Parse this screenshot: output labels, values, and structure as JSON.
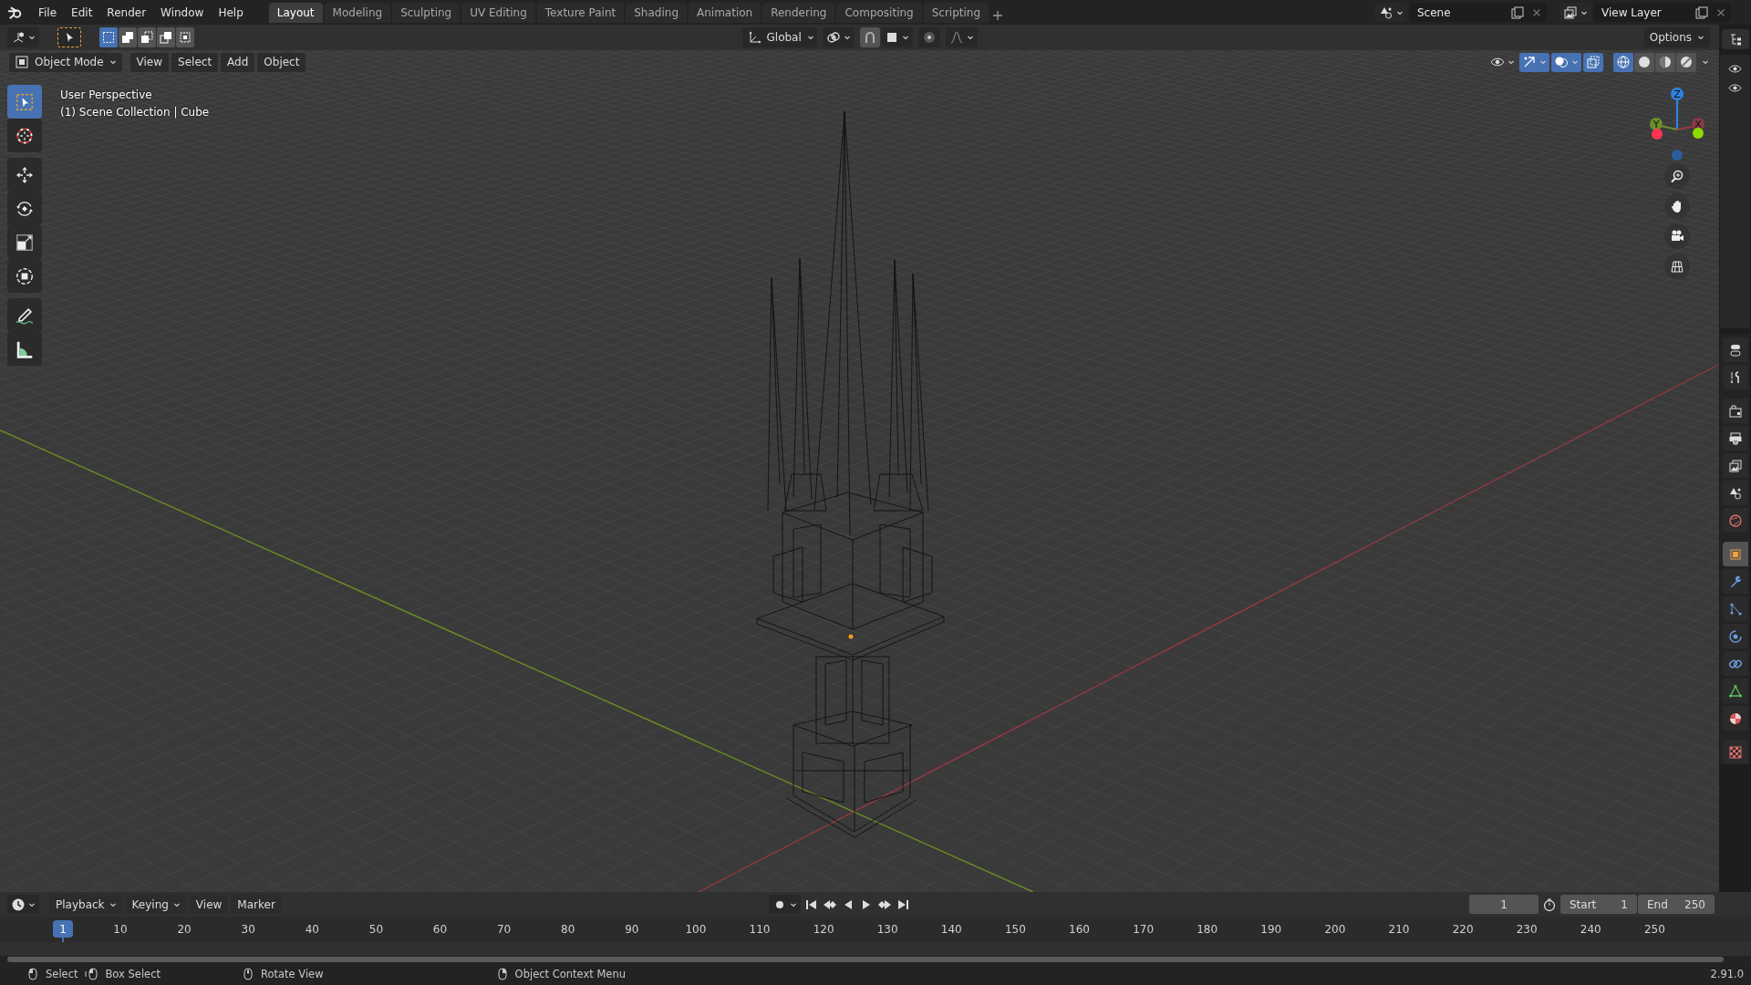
{
  "menu_bar": {
    "menus": [
      "File",
      "Edit",
      "Render",
      "Window",
      "Help"
    ]
  },
  "workspaces": [
    {
      "label": "Layout",
      "selected": true
    },
    {
      "label": "Modeling",
      "selected": false
    },
    {
      "label": "Sculpting",
      "selected": false
    },
    {
      "label": "UV Editing",
      "selected": false
    },
    {
      "label": "Texture Paint",
      "selected": false
    },
    {
      "label": "Shading",
      "selected": false
    },
    {
      "label": "Animation",
      "selected": false
    },
    {
      "label": "Rendering",
      "selected": false
    },
    {
      "label": "Compositing",
      "selected": false
    },
    {
      "label": "Scripting",
      "selected": false
    }
  ],
  "scene": {
    "name": "Scene"
  },
  "view_layer": {
    "name": "View Layer"
  },
  "tool_header": {
    "select_modes": [
      {
        "selected": true
      },
      {
        "selected": false
      },
      {
        "selected": false
      },
      {
        "selected": false
      },
      {
        "selected": false
      }
    ],
    "orientation": "Global",
    "options": "Options"
  },
  "viewport": {
    "mode": "Object Mode",
    "menus": [
      "View",
      "Select",
      "Add",
      "Object"
    ],
    "perspective": "User Perspective",
    "collection": "(1) Scene Collection | Cube",
    "overlays": [
      {
        "kind": "visibility",
        "on": false
      },
      {
        "kind": "gizmos",
        "on": true
      },
      {
        "kind": "overlays",
        "on": true
      },
      {
        "kind": "xray",
        "on": true
      }
    ],
    "shading": [
      {
        "kind": "wireframe",
        "selected": true
      },
      {
        "kind": "solid",
        "selected": false
      },
      {
        "kind": "material",
        "selected": false
      },
      {
        "kind": "rendered",
        "selected": false
      }
    ],
    "tools": [
      {
        "kind": "select_box",
        "selected": true
      },
      {
        "kind": "cursor",
        "selected": false
      },
      {
        "kind": "move",
        "selected": false
      },
      {
        "kind": "rotate",
        "selected": false
      },
      {
        "kind": "scale",
        "selected": false
      },
      {
        "kind": "transform",
        "selected": false
      },
      {
        "kind": "annotate",
        "selected": false
      },
      {
        "kind": "measure",
        "selected": false
      }
    ],
    "gizmo_axes": [
      "Z",
      "Y",
      "X"
    ]
  },
  "properties_tabs": [
    {
      "kind": "tool",
      "selected": false
    },
    {
      "kind": "render",
      "selected": false
    },
    {
      "kind": "output",
      "selected": false
    },
    {
      "kind": "view_layer",
      "selected": false
    },
    {
      "kind": "scene",
      "selected": false
    },
    {
      "kind": "world",
      "selected": false
    },
    {
      "kind": "object",
      "selected": true
    },
    {
      "kind": "modifiers",
      "selected": false
    },
    {
      "kind": "particles",
      "selected": false
    },
    {
      "kind": "physics",
      "selected": false
    },
    {
      "kind": "constraints",
      "selected": false
    },
    {
      "kind": "data",
      "selected": false
    },
    {
      "kind": "material",
      "selected": false
    },
    {
      "kind": "texture",
      "selected": false
    }
  ],
  "timeline": {
    "menus": [
      {
        "label": "Playback",
        "dropdown": true
      },
      {
        "label": "Keying",
        "dropdown": true
      },
      {
        "label": "View",
        "dropdown": false
      },
      {
        "label": "Marker",
        "dropdown": false
      }
    ],
    "current_frame": "1",
    "start_label": "Start",
    "start": "1",
    "end_label": "End",
    "end": "250",
    "playhead": "1",
    "ruler": [
      "10",
      "20",
      "30",
      "40",
      "50",
      "60",
      "70",
      "80",
      "90",
      "100",
      "110",
      "120",
      "130",
      "140",
      "150",
      "160",
      "170",
      "180",
      "190",
      "200",
      "210",
      "220",
      "230",
      "240",
      "250"
    ]
  },
  "status_bar": {
    "hints": [
      {
        "kind": "left_click",
        "label": "Select"
      },
      {
        "kind": "left_drag",
        "label": "Box Select"
      },
      {
        "kind": "middle_drag",
        "label": "Rotate View"
      },
      {
        "kind": "right_click",
        "label": "Object Context Menu"
      }
    ],
    "version": "2.91.0"
  }
}
